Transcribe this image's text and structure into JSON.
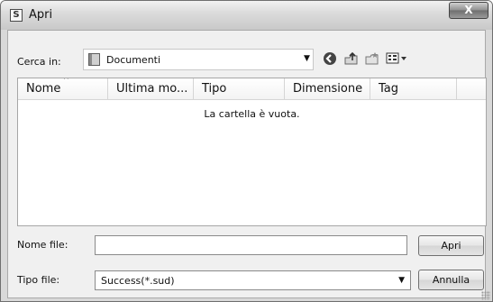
{
  "window": {
    "title": "Apri",
    "app_icon_letter": "S",
    "close_glyph": "X"
  },
  "toolbar": {
    "look_in_label": "Cerca in:",
    "look_in_value": "Documenti",
    "icons": [
      "back-icon",
      "up-folder-icon",
      "new-folder-icon",
      "view-menu-icon"
    ]
  },
  "file_list": {
    "columns": [
      "Nome",
      "Ultima mo...",
      "Tipo",
      "Dimensione",
      "Tag"
    ],
    "sorted_column": "Nome",
    "empty_message": "La cartella è vuota."
  },
  "file_name": {
    "label": "Nome file:",
    "value": ""
  },
  "file_type": {
    "label": "Tipo file:",
    "value": "Success(*.sud)"
  },
  "buttons": {
    "open": "Apri",
    "cancel": "Annulla"
  },
  "colors": {
    "title_gradient_top": "#f2f2f2",
    "dialog_background": "#f0f0f0",
    "close_button": "#8e8e8e"
  }
}
